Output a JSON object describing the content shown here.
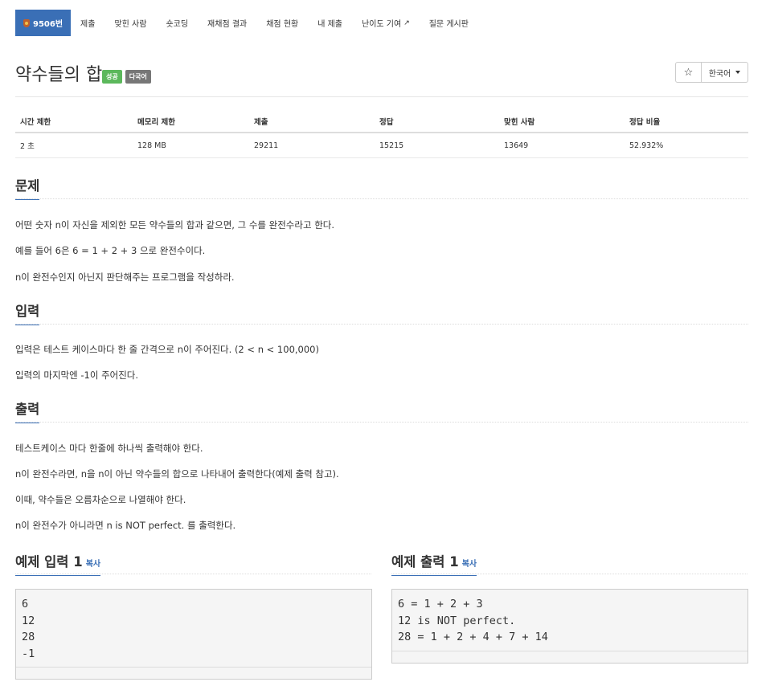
{
  "nav": {
    "problem_id": "9506번",
    "tabs": [
      "제출",
      "맞힌 사람",
      "숏코딩",
      "재채점 결과",
      "채점 현황",
      "내 제출",
      "난이도 기여",
      "질문 게시판"
    ]
  },
  "problem": {
    "title": "약수들의 합",
    "badges": {
      "status": "성공",
      "multilang": "다국어"
    },
    "star": "☆",
    "language": "한국어"
  },
  "stats": {
    "headers": [
      "시간 제한",
      "메모리 제한",
      "제출",
      "정답",
      "맞힌 사람",
      "정답 비율"
    ],
    "values": [
      "2 초",
      "128 MB",
      "29211",
      "15215",
      "13649",
      "52.932%"
    ]
  },
  "sections": {
    "problem": {
      "title": "문제",
      "lines": [
        "어떤 숫자 n이 자신을 제외한 모든 약수들의 합과 같으면, 그 수를 완전수라고 한다.",
        "예를 들어 6은 6 = 1 + 2 + 3 으로 완전수이다.",
        "n이 완전수인지 아닌지 판단해주는 프로그램을 작성하라."
      ]
    },
    "input": {
      "title": "입력",
      "lines": [
        "입력은 테스트 케이스마다 한 줄 간격으로 n이 주어진다. (2 < n < 100,000)",
        "입력의 마지막엔 -1이 주어진다."
      ]
    },
    "output": {
      "title": "출력",
      "lines": [
        "테스트케이스 마다 한줄에 하나씩 출력해야 한다.",
        "n이 완전수라면, n을 n이 아닌 약수들의 합으로 나타내어 출력한다(예제 출력 참고).",
        "이때, 약수들은 오름차순으로 나열해야 한다.",
        "n이 완전수가 아니라면 n is NOT perfect. 를 출력한다."
      ]
    }
  },
  "samples": {
    "input": {
      "title": "예제 입력 1",
      "copy": "복사",
      "code": "6\n12\n28\n-1"
    },
    "output": {
      "title": "예제 출력 1",
      "copy": "복사",
      "code": "6 = 1 + 2 + 3\n12 is NOT perfect.\n28 = 1 + 2 + 4 + 7 + 14"
    }
  }
}
